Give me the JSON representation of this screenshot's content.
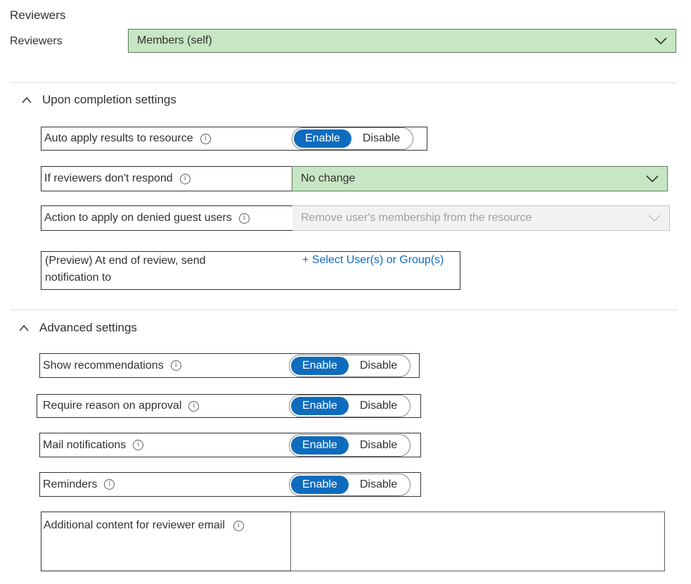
{
  "reviewers": {
    "section_title": "Reviewers",
    "label": "Reviewers",
    "value": "Members (self)"
  },
  "completion": {
    "title": "Upon completion settings",
    "auto_apply": {
      "label": "Auto apply results to resource",
      "enable": "Enable",
      "disable": "Disable",
      "selected": "Enable"
    },
    "no_response": {
      "label": "If reviewers don't respond",
      "value": "No change"
    },
    "denied_guests": {
      "label": "Action to apply on denied guest users",
      "value": "Remove user's membership from the resource"
    },
    "notify": {
      "label_line1": "(Preview) At end of review, send",
      "label_line2": "notification to",
      "link": "+ Select User(s) or Group(s)"
    }
  },
  "advanced": {
    "title": "Advanced settings",
    "rows": [
      {
        "label": "Show recommendations",
        "enable": "Enable",
        "disable": "Disable",
        "selected": "Enable"
      },
      {
        "label": "Require reason on approval",
        "enable": "Enable",
        "disable": "Disable",
        "selected": "Enable"
      },
      {
        "label": "Mail notifications",
        "enable": "Enable",
        "disable": "Disable",
        "selected": "Enable"
      },
      {
        "label": "Reminders",
        "enable": "Enable",
        "disable": "Disable",
        "selected": "Enable"
      }
    ],
    "additional_content": {
      "label": "Additional content for reviewer email",
      "value": ""
    }
  },
  "icons": {
    "info": "info-icon",
    "chevron": "chevron-down-icon",
    "collapse": "chevron-up-icon"
  },
  "colors": {
    "accent": "#0f6cbd",
    "highlight": "#c7e6c4"
  }
}
